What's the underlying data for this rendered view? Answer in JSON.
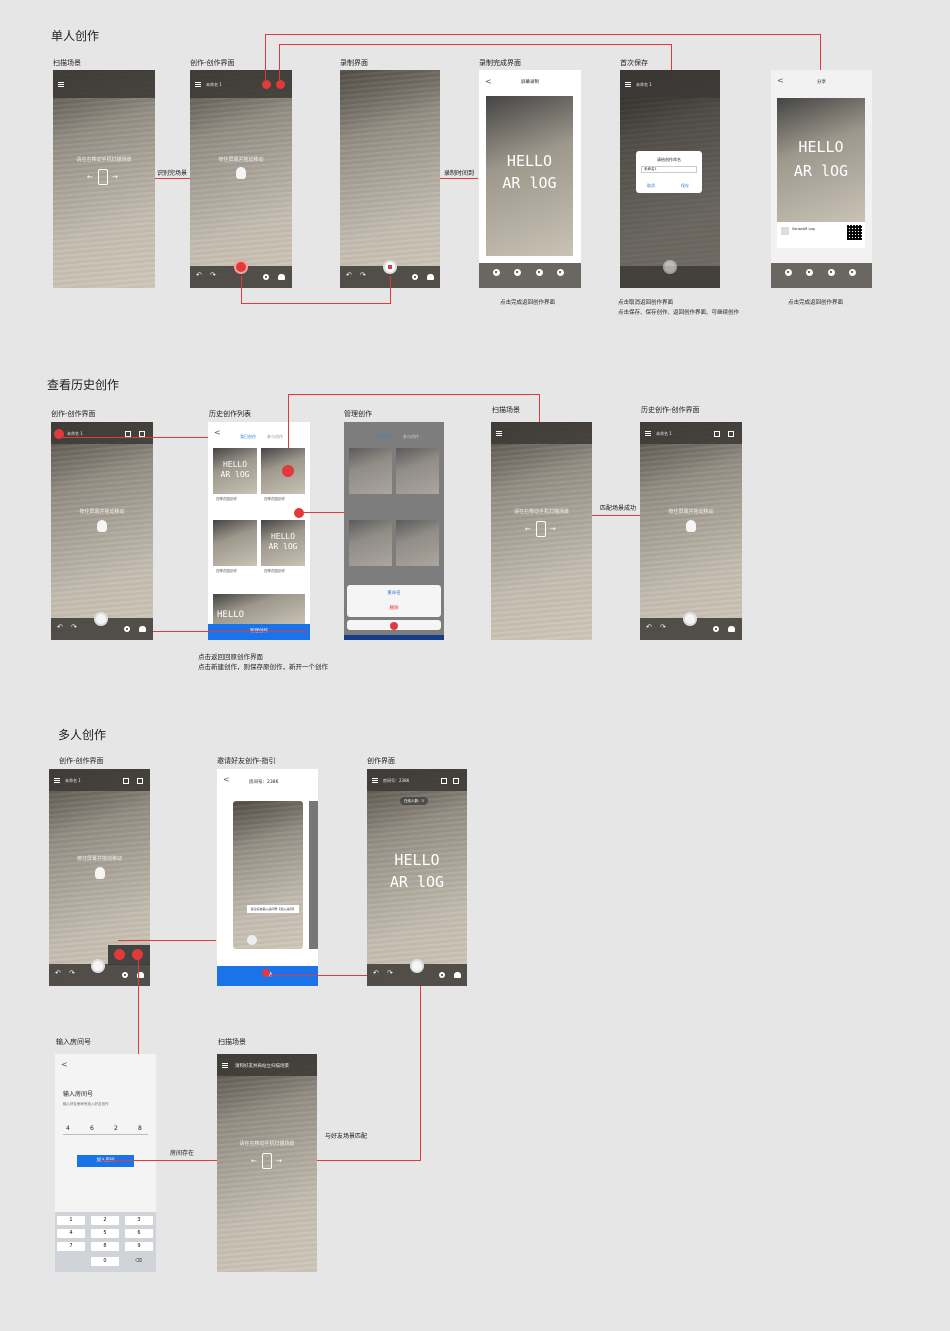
{
  "sections": {
    "single": "单人创作",
    "history": "查看历史创作",
    "multi": "多人创作"
  },
  "labels": {
    "s1_scan": "扫描场景",
    "s1_create": "创作-创作界面",
    "s1_record": "录制界面",
    "s1_record_done": "录制完成界面",
    "s1_first_save": "首次保存",
    "h_create": "创作-创作界面",
    "h_list": "历史创作列表",
    "h_manage": "管理创作",
    "h_scan": "扫描场景",
    "h_history_create": "历史创作-创作界面",
    "m_create": "创作-创作界面",
    "m_invite": "邀请好友创作-指引",
    "m_create2": "创作界面",
    "m_room": "输入房间号",
    "m_scan": "扫描场景"
  },
  "connectors": {
    "recognized": "识别完场景",
    "record_time": "录制时间到",
    "matched": "匹配场景成功",
    "room_exists": "房间存在",
    "match_friend": "与好友场景匹配"
  },
  "notes": {
    "record_done": "点击完成返回创作界面",
    "first_save_1": "点击取消返回创作界面",
    "first_save_2": "点击保存、保存创作、返回创作界面、可继续创作",
    "share": "点击完成返回创作界面",
    "history_1": "点击返回回原创作界面",
    "history_2": "点击新建创作，则保存原创作，新开一个创作"
  },
  "screen_text": {
    "scan_hint": "请在右移动手机扫描场景",
    "create_hint": "按住屏幕并拖动移动",
    "untitled": "未命名 1",
    "hello": "HELLO",
    "ar_log": "AR lOG",
    "screen_record": "屏幕录制",
    "save_dialog_title": "请给创作命名",
    "save_dialog_input": "未命名1",
    "cancel": "取消",
    "save": "保存",
    "share_title": "分享",
    "share_app": "SenseAR Log",
    "tab_mine": "我已创作",
    "tab_other": "参与创作",
    "card_title": "四季花园创作",
    "card_date": "2018-06-27",
    "rename": "重命名",
    "delete": "删除",
    "new_create": "新建创作",
    "room_no": "房间号：2386",
    "online": "在线人数：3",
    "invite_tip": "请让好友输入房间号【加入房间】",
    "invite_btn": "邀请",
    "scan_with_friend": "请和好友并肩站立扫描场景",
    "room_title": "输入房间号",
    "room_sub": "输入好友房间号加入好友创作",
    "join_room": "加入房间",
    "digits": [
      "4",
      "6",
      "2",
      "8"
    ],
    "keys": [
      "1",
      "2",
      "3",
      "4",
      "5",
      "6",
      "7",
      "8",
      "9",
      "0"
    ]
  }
}
